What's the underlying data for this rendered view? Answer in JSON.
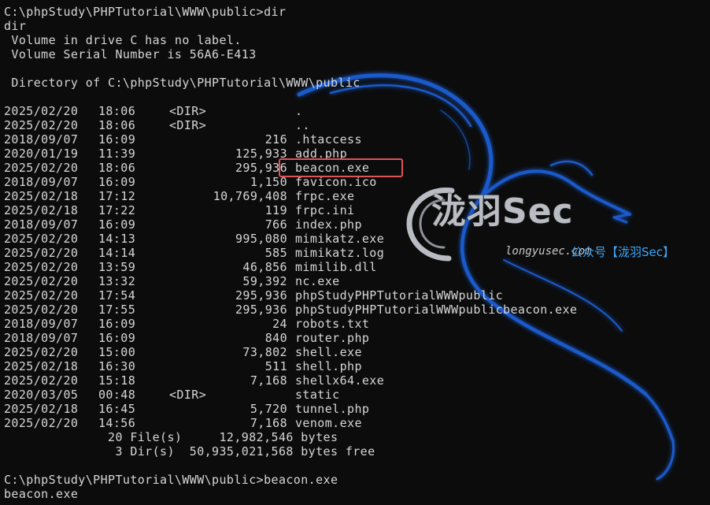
{
  "terminal": {
    "lines_top": [
      "C:\\phpStudy\\PHPTutorial\\WWW\\public>dir",
      "dir",
      " Volume in drive C has no label.",
      " Volume Serial Number is 56A6-E413",
      "",
      " Directory of C:\\phpStudy\\PHPTutorial\\WWW\\public",
      ""
    ],
    "entries": [
      {
        "date": "2025/02/20",
        "time": "18:06",
        "size": "<DIR>",
        "name": "."
      },
      {
        "date": "2025/02/20",
        "time": "18:06",
        "size": "<DIR>",
        "name": ".."
      },
      {
        "date": "2018/09/07",
        "time": "16:09",
        "size": "216",
        "name": ".htaccess"
      },
      {
        "date": "2020/01/19",
        "time": "11:39",
        "size": "125,933",
        "name": "add.php"
      },
      {
        "date": "2025/02/20",
        "time": "18:06",
        "size": "295,936",
        "name": "beacon.exe"
      },
      {
        "date": "2018/09/07",
        "time": "16:09",
        "size": "1,150",
        "name": "favicon.ico"
      },
      {
        "date": "2025/02/18",
        "time": "17:12",
        "size": "10,769,408",
        "name": "frpc.exe"
      },
      {
        "date": "2025/02/18",
        "time": "17:22",
        "size": "119",
        "name": "frpc.ini"
      },
      {
        "date": "2018/09/07",
        "time": "16:09",
        "size": "766",
        "name": "index.php"
      },
      {
        "date": "2025/02/20",
        "time": "14:13",
        "size": "995,080",
        "name": "mimikatz.exe"
      },
      {
        "date": "2025/02/20",
        "time": "14:14",
        "size": "585",
        "name": "mimikatz.log"
      },
      {
        "date": "2025/02/20",
        "time": "13:59",
        "size": "46,856",
        "name": "mimilib.dll"
      },
      {
        "date": "2025/02/20",
        "time": "13:32",
        "size": "59,392",
        "name": "nc.exe"
      },
      {
        "date": "2025/02/20",
        "time": "17:54",
        "size": "295,936",
        "name": "phpStudyPHPTutorialWWWpublic"
      },
      {
        "date": "2025/02/20",
        "time": "17:55",
        "size": "295,936",
        "name": "phpStudyPHPTutorialWWWpublicbeacon.exe"
      },
      {
        "date": "2018/09/07",
        "time": "16:09",
        "size": "24",
        "name": "robots.txt"
      },
      {
        "date": "2018/09/07",
        "time": "16:09",
        "size": "840",
        "name": "router.php"
      },
      {
        "date": "2025/02/20",
        "time": "15:00",
        "size": "73,802",
        "name": "shell.exe"
      },
      {
        "date": "2025/02/18",
        "time": "16:30",
        "size": "511",
        "name": "shell.php"
      },
      {
        "date": "2025/02/20",
        "time": "15:18",
        "size": "7,168",
        "name": "shellx64.exe"
      },
      {
        "date": "2020/03/05",
        "time": "00:48",
        "size": "<DIR>",
        "name": "static"
      },
      {
        "date": "2025/02/18",
        "time": "16:45",
        "size": "5,720",
        "name": "tunnel.php"
      },
      {
        "date": "2025/02/20",
        "time": "14:56",
        "size": "7,168",
        "name": "venom.exe"
      }
    ],
    "summary_files": "              20 File(s)     12,982,546 bytes",
    "summary_dirs": "               3 Dir(s)  50,935,021,568 bytes free",
    "lines_bottom": [
      "",
      "C:\\phpStudy\\PHPTutorial\\WWW\\public>beacon.exe",
      "beacon.exe"
    ],
    "highlighted_entry": "beacon.exe"
  },
  "watermark": {
    "logo_text": "泷羽Sec",
    "subtitle": "longyusec.com",
    "cn_label": "公众号【泷羽Sec】"
  },
  "colors": {
    "background": "#0c0c0c",
    "text": "#d6d6d6",
    "highlight_border": "#e0525a",
    "dragon_blue": "#1f5fd6",
    "watermark_cn": "#3aa8ff"
  }
}
